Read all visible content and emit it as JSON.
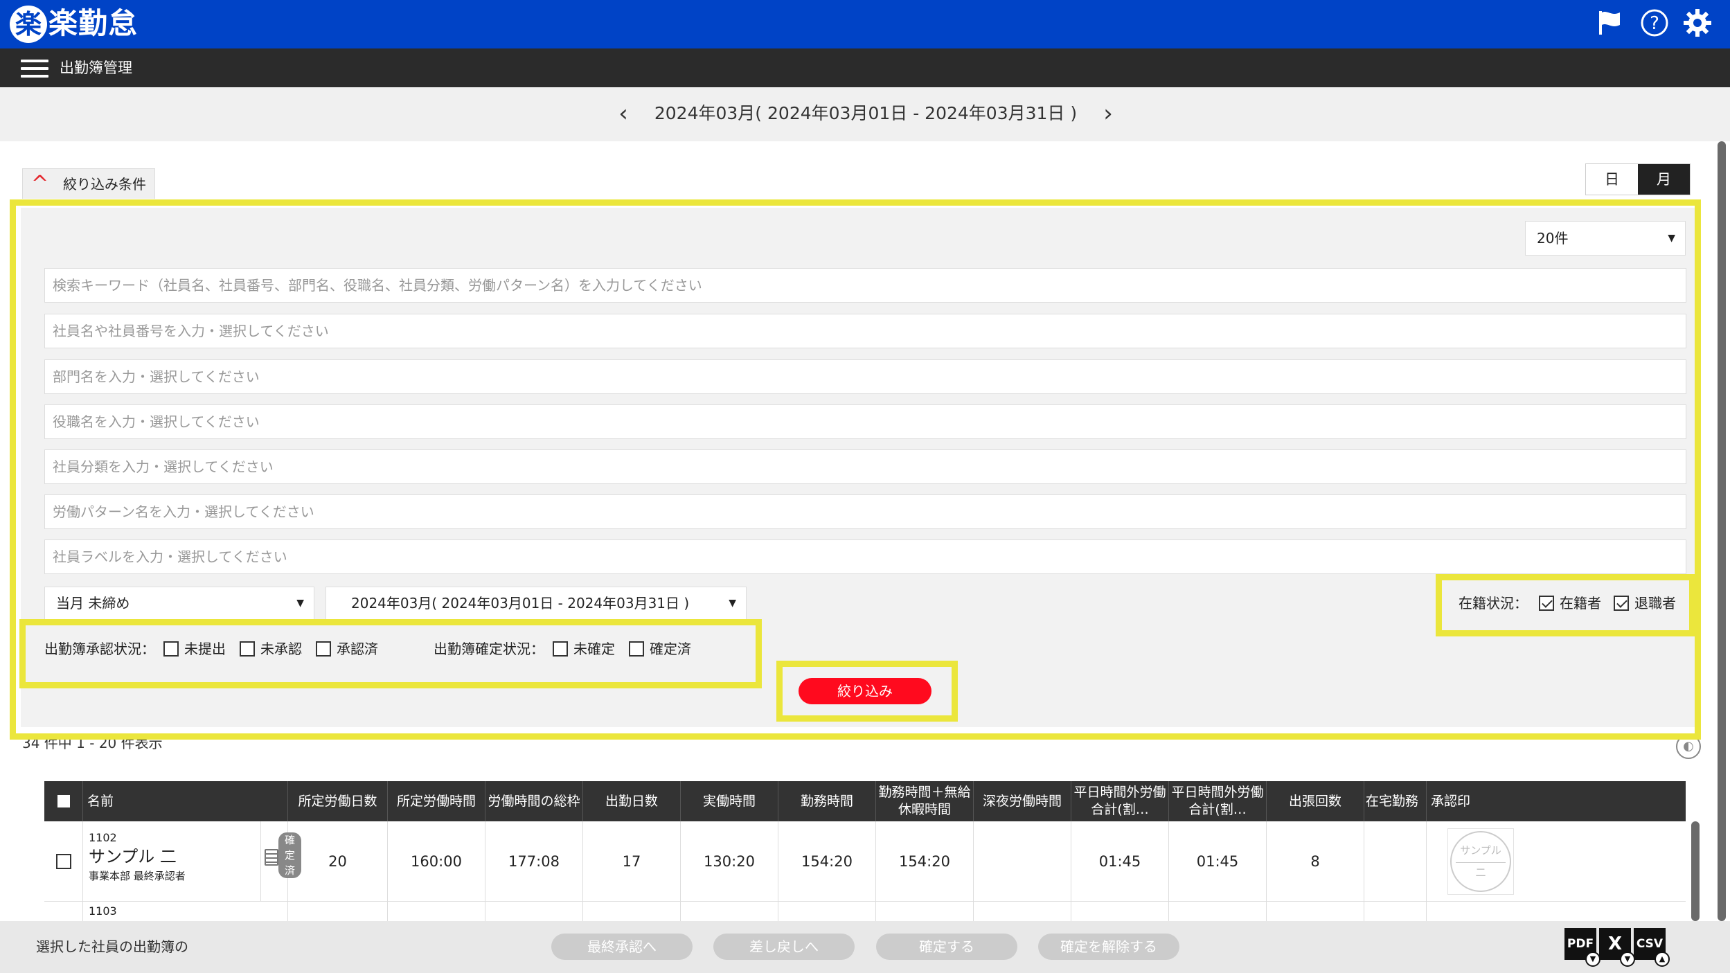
{
  "app": {
    "logo_mark": "楽",
    "title": "楽勤怠",
    "icons": [
      "flag-icon",
      "help-icon",
      "gear-icon"
    ]
  },
  "nav": {
    "menu_icon": "hamburger-icon",
    "page_title": "出勤簿管理"
  },
  "period": {
    "label": "2024年03月( 2024年03月01日 - 2024年03月31日 )",
    "prev": "‹",
    "next": "›"
  },
  "filter": {
    "toggle_label": "絞り込み条件",
    "view_day": "日",
    "view_month": "月",
    "per_page": "20件",
    "fields": [
      {
        "placeholder": "検索キーワード（社員名、社員番号、部門名、役職名、社員分類、労働パターン名）を入力してください"
      },
      {
        "placeholder": "社員名や社員番号を入力・選択してください"
      },
      {
        "placeholder": "部門名を入力・選択してください"
      },
      {
        "placeholder": "役職名を入力・選択してください"
      },
      {
        "placeholder": "社員分類を入力・選択してください"
      },
      {
        "placeholder": "労働パターン名を入力・選択してください"
      },
      {
        "placeholder": "社員ラベルを入力・選択してください"
      }
    ],
    "closing_select": "当月 未締め",
    "period_select": "2024年03月( 2024年03月01日 - 2024年03月31日 )",
    "enrollment": {
      "label": "在籍状況：",
      "options": [
        {
          "label": "在籍者",
          "checked": true
        },
        {
          "label": "退職者",
          "checked": true
        }
      ]
    },
    "approval": {
      "label": "出勤簿承認状況：",
      "options": [
        {
          "label": "未提出",
          "checked": false
        },
        {
          "label": "未承認",
          "checked": false
        },
        {
          "label": "承認済",
          "checked": false
        }
      ]
    },
    "confirm": {
      "label": "出勤簿確定状況：",
      "options": [
        {
          "label": "未確定",
          "checked": false
        },
        {
          "label": "確定済",
          "checked": false
        }
      ]
    },
    "submit": "絞り込み"
  },
  "list": {
    "count_text": "34 件中 1 - 20 件表示",
    "columns": [
      "名前",
      "所定労働日数",
      "所定労働時間",
      "労働時間の総枠",
      "出勤日数",
      "実働時間",
      "勤務時間",
      "勤務時間＋無給休暇時間",
      "深夜労働時間",
      "平日時間外労働合計(割…",
      "平日時間外労働合計(割…",
      "出張回数",
      "在宅勤務",
      "承認印"
    ],
    "rows": [
      {
        "emp_no": "1102",
        "name": "サンプル 二",
        "dept": "事業本部 最終承認者",
        "badge": "確定済",
        "values": [
          "20",
          "160:00",
          "177:08",
          "17",
          "130:20",
          "154:20",
          "154:20",
          "",
          "01:45",
          "01:45",
          "8",
          ""
        ],
        "stamp_top": "サンプル",
        "stamp_bottom": "二"
      }
    ],
    "next_row_emp_no": "1103"
  },
  "footer": {
    "label": "選択した社員の出勤簿の",
    "buttons": [
      "最終承認へ",
      "差し戻しへ",
      "確定する",
      "確定を解除する"
    ],
    "exports": [
      "PDF",
      "X",
      "CSV"
    ]
  }
}
